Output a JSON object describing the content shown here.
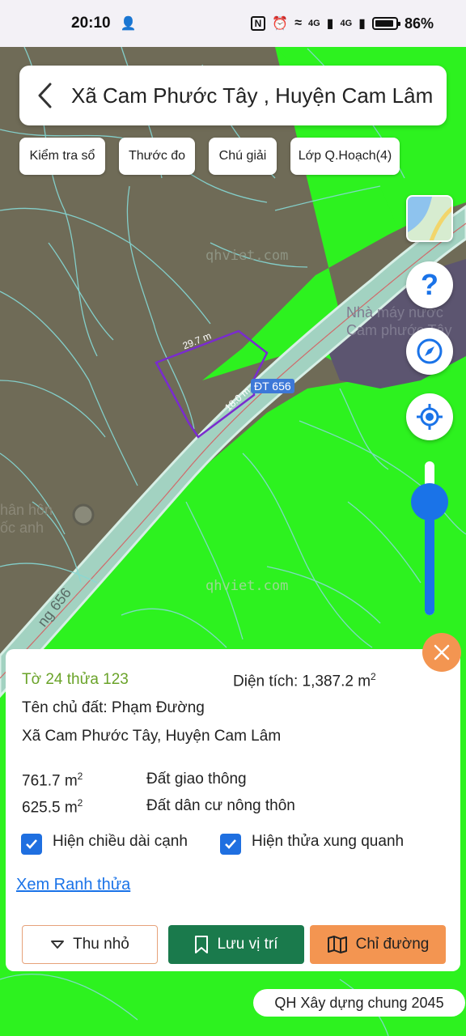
{
  "status": {
    "time": "20:10",
    "nfc": "N",
    "net1": "4G",
    "net2": "4G",
    "battery": "86%"
  },
  "header": {
    "title": "Xã Cam Phước Tây , Huyện Cam Lâm"
  },
  "chips": [
    "Kiểm tra sổ",
    "Thước đo",
    "Chú giải",
    "Lớp Q.Hoạch(4)"
  ],
  "map": {
    "watermark": "qhviet.com",
    "edge1": "29.7 m",
    "edge2": "18.0 m",
    "road_badge": "ĐT 656",
    "road_name": "ng 656",
    "poi1_line1": "Nhà máy nước",
    "poi1_line2": "Cam phước Tây",
    "poi2_line1": "hân hôn",
    "poi2_line2": "ốc anh",
    "colors": {
      "green_zone": "#2df21f",
      "residential": "#6f6b57",
      "road": "#a2d2c1",
      "parcel_outline": "#7a2bcf"
    }
  },
  "controls": {
    "help_icon": "question-icon",
    "compass_icon": "compass-icon",
    "locate_icon": "crosshair-icon",
    "opacity_level": 0.74
  },
  "panel": {
    "parcel_id": "Tờ 24 thửa 123",
    "area_label": "Diện tích: 1,387.2 m",
    "area_sup": "2",
    "owner": "Tên chủ đất: Phạm Đường",
    "address": "Xã Cam Phước Tây, Huyện Cam Lâm",
    "land_uses": [
      {
        "area": "761.7 m",
        "sup": "2",
        "type": "Đất giao thông"
      },
      {
        "area": "625.5 m",
        "sup": "2",
        "type": "Đất dân cư nông thôn"
      }
    ],
    "checkbox1": "Hiện chiều dài cạnh",
    "checkbox2": "Hiện thửa xung quanh",
    "link": "Xem Ranh thửa",
    "btn_shrink": "Thu nhỏ",
    "btn_save": "Lưu vị trí",
    "btn_directions": "Chỉ đường"
  },
  "plan_badge": "QH Xây dựng chung 2045"
}
